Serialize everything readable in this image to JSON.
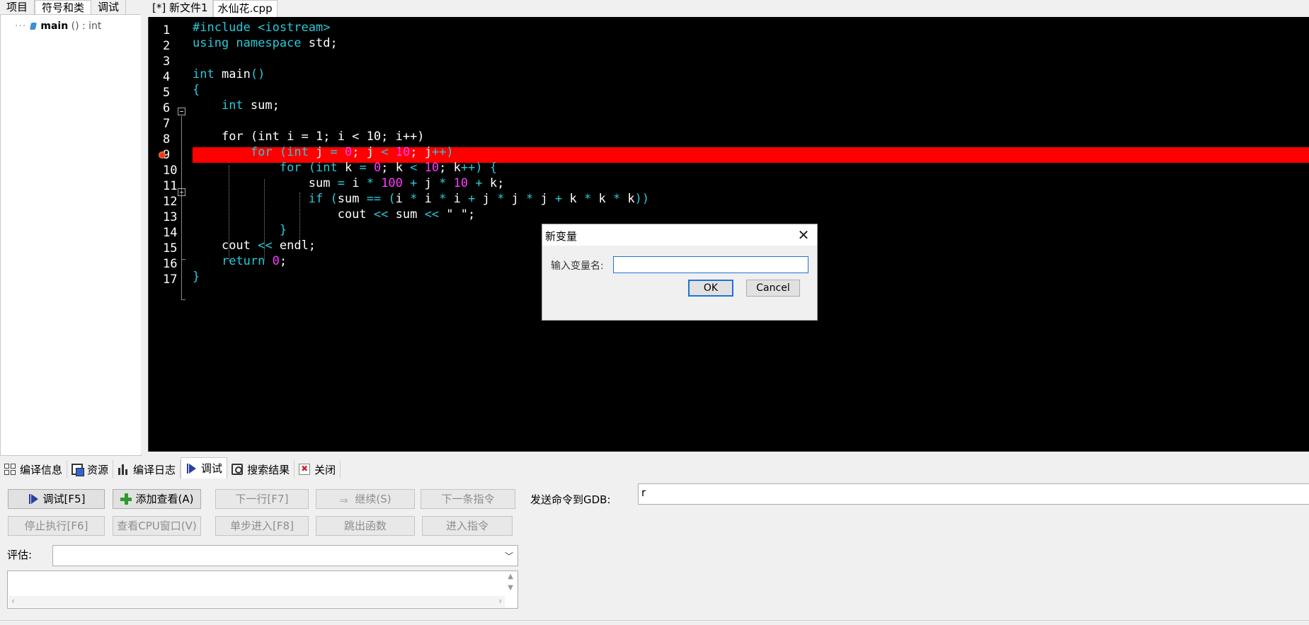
{
  "left_panel": {
    "tabs": [
      "项目",
      "符号和类",
      "调试"
    ],
    "active_tab": 1,
    "tree": {
      "name": "main",
      "signature": "() : int"
    }
  },
  "editor": {
    "tabs": [
      "[*] 新文件1",
      "水仙花.cpp"
    ],
    "active_tab": 1,
    "line_numbers": [
      "1",
      "2",
      "3",
      "4",
      "5",
      "6",
      "7",
      "8",
      "9",
      "10",
      "11",
      "12",
      "13",
      "14",
      "15",
      "16",
      "17"
    ],
    "highlighted_line": 8,
    "colors": {
      "background": "#000000",
      "highlight": "#ff0000",
      "keyword": "#29c9d8",
      "number": "#ff3bff",
      "text": "#ffffff"
    }
  },
  "dialog": {
    "title": "新变量",
    "close_icon": "close-icon",
    "label": "输入变量名:",
    "input_value": "",
    "ok_label": "OK",
    "cancel_label": "Cancel"
  },
  "bottom_tabs": [
    {
      "label": "编译信息",
      "icon": "grid-icon"
    },
    {
      "label": "资源",
      "icon": "resource-icon"
    },
    {
      "label": "编译日志",
      "icon": "bar-chart-icon"
    },
    {
      "label": "调试",
      "icon": "debug-icon"
    },
    {
      "label": "搜索结果",
      "icon": "search-icon"
    },
    {
      "label": "关闭",
      "icon": "close-icon"
    }
  ],
  "bottom_active_tab": 3,
  "debug": {
    "debug_btn": "调试[F5]",
    "add_watch_btn": "添加查看(A)",
    "next_line_btn": "下一行[F7]",
    "continue_btn": "继续(S)",
    "next_instr_btn": "下一条指令",
    "stop_btn": "停止执行[F6]",
    "cpu_btn": "查看CPU窗口(V)",
    "step_into_btn": "单步进入[F8]",
    "skip_func_btn": "跳出函数",
    "into_instr_btn": "进入指令",
    "gdb_label": "发送命令到GDB:",
    "gdb_value": "r",
    "eval_label": "评估:",
    "eval_value": ""
  }
}
